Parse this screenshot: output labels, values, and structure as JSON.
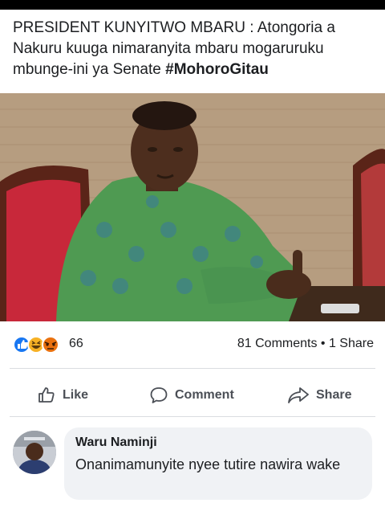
{
  "post": {
    "text_main": "PRESIDENT KUNYITWO MBARU : Atongoria a Nakuru kuuga nimaranyita mbaru mogaruruku mbunge-ini ya Senate ",
    "hashtag": "#MohoroGitau"
  },
  "photo": {
    "subject": "man-in-green-patterned-shirt-at-desk"
  },
  "reactions": {
    "icons": [
      "like-icon",
      "haha-icon",
      "angry-icon"
    ],
    "count": "66",
    "comments_shares": "81 Comments • 1 Share"
  },
  "actions": {
    "like_label": "Like",
    "comment_label": "Comment",
    "share_label": "Share"
  },
  "comment": {
    "author": "Waru Naminji",
    "text": "Onanimamunyite nyee tutire nawira wake"
  },
  "colors": {
    "like_blue": "#1877f2",
    "angry_orange": "#e9710f",
    "haha_yellow": "#f7b125",
    "text": "#1c1e21",
    "muted": "#4b4f56"
  }
}
